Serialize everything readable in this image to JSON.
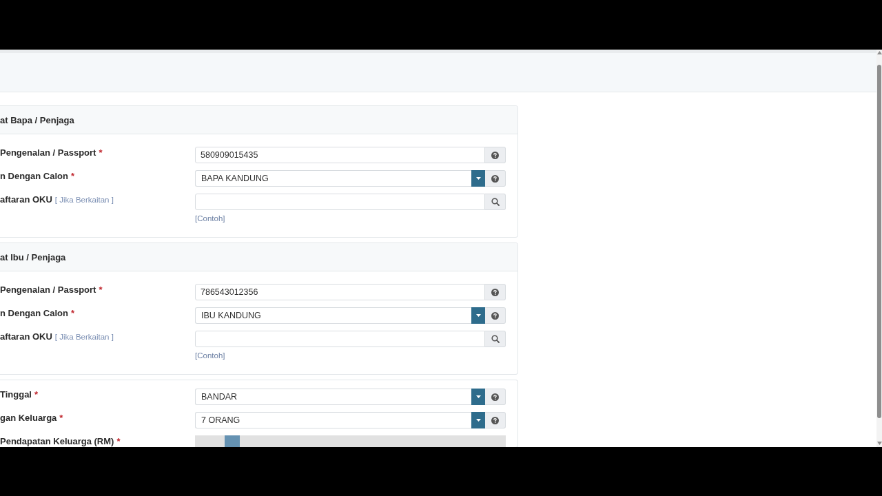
{
  "sections": [
    {
      "title": "at Bapa / Penjaga",
      "fields": [
        {
          "kind": "text",
          "label": "Pengenalan / Passport",
          "required_mark": "*",
          "value": "580909015435"
        },
        {
          "kind": "select",
          "label": "n Dengan Calon",
          "required_mark": "*",
          "value": "BAPA KANDUNG"
        },
        {
          "kind": "search",
          "label": "aftaran OKU",
          "hint": "[ Jika Berkaitan ]",
          "link": "[Contoh]"
        }
      ]
    },
    {
      "title": "at Ibu / Penjaga",
      "fields": [
        {
          "kind": "text",
          "label": "Pengenalan / Passport",
          "required_mark": "*",
          "value": "786543012356"
        },
        {
          "kind": "select",
          "label": "n Dengan Calon",
          "required_mark": "*",
          "value": "IBU KANDUNG"
        },
        {
          "kind": "search",
          "label": "aftaran OKU",
          "hint": "[ Jika Berkaitan ]",
          "link": "[Contoh]"
        }
      ]
    },
    {
      "fields": [
        {
          "kind": "select",
          "label": "Tinggal",
          "required_mark": "*",
          "value": "BANDAR"
        },
        {
          "kind": "select",
          "label": "gan Keluarga",
          "required_mark": "*",
          "value": "7 ORANG"
        },
        {
          "kind": "slider",
          "label": "Pendapatan Keluarga (RM)",
          "required_mark": "*",
          "level": 0.1
        }
      ]
    }
  ]
}
